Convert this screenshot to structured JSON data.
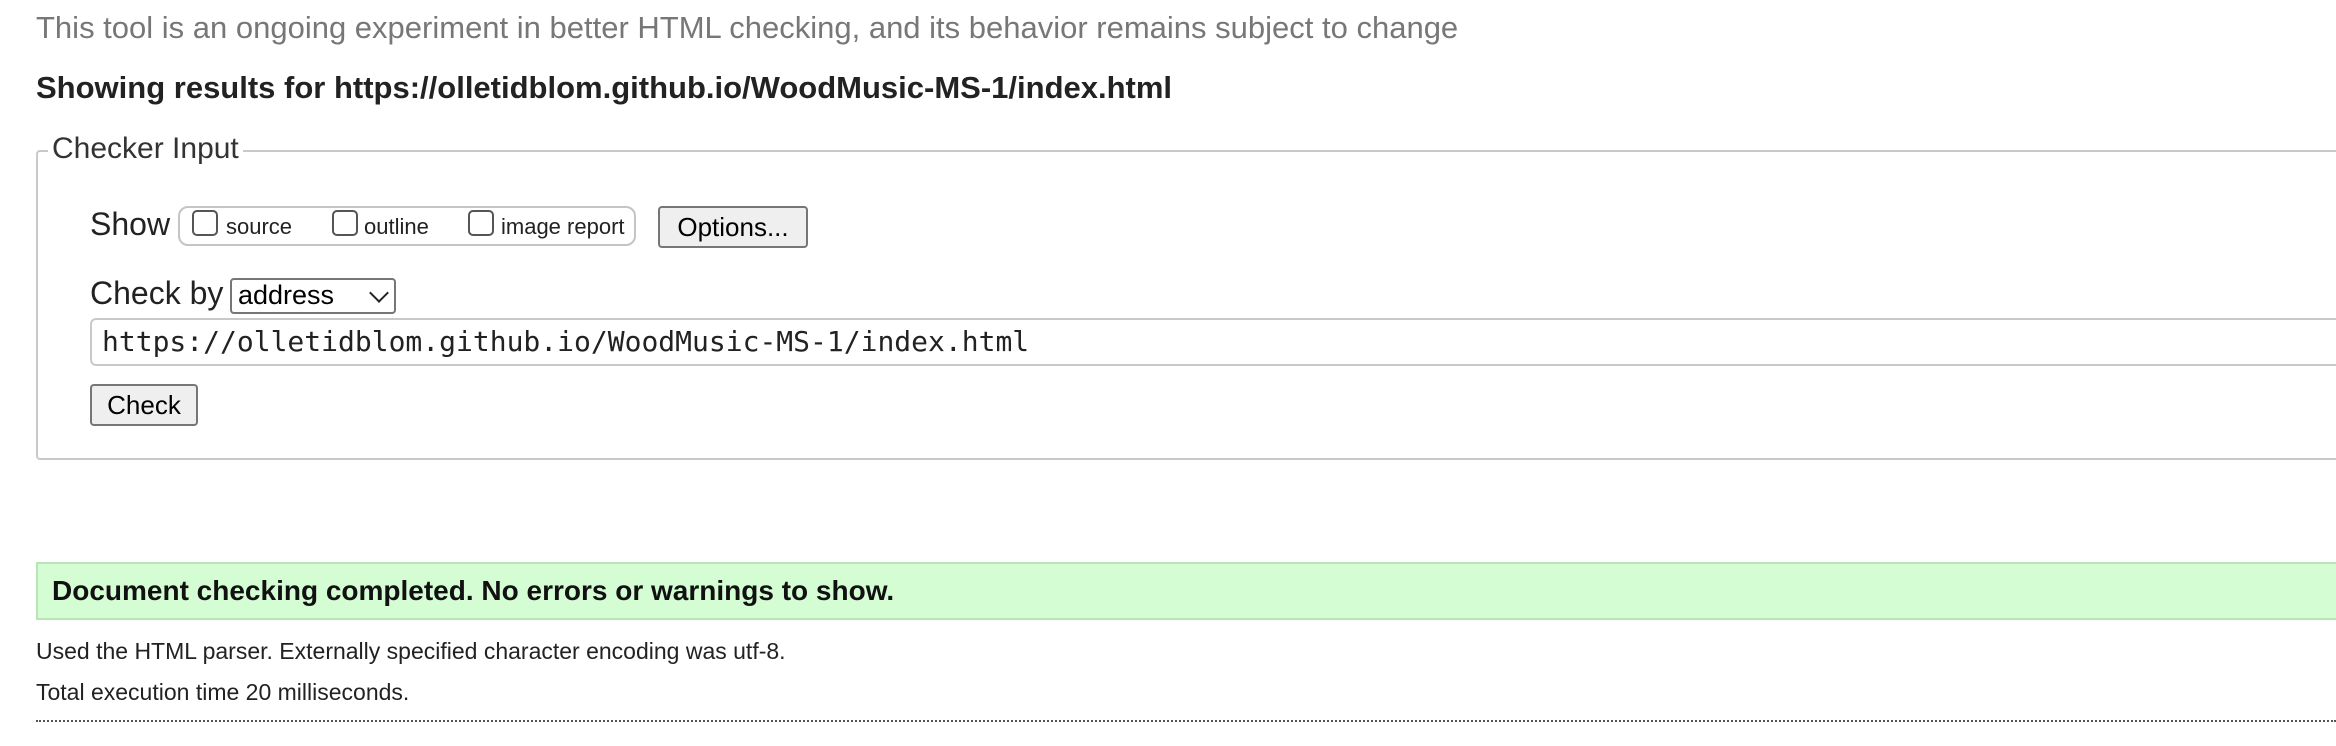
{
  "header": {
    "subtitle": "This tool is an ongoing experiment in better HTML checking, and its behavior remains subject to change",
    "results_heading": "Showing results for https://olletidblom.github.io/WoodMusic-MS-1/index.html"
  },
  "checker": {
    "legend": "Checker Input",
    "show_label": "Show",
    "show_options": [
      {
        "label": "source",
        "checked": false
      },
      {
        "label": "outline",
        "checked": false
      },
      {
        "label": "image report",
        "checked": false
      }
    ],
    "options_button": "Options...",
    "check_by_label": "Check by",
    "check_by_selected": "address",
    "url_value": "https://olletidblom.github.io/WoodMusic-MS-1/index.html",
    "check_button": "Check"
  },
  "results": {
    "success_message": "Document checking completed. No errors or warnings to show.",
    "parser_info": "Used the HTML parser. Externally specified character encoding was utf-8.",
    "execution_time": "Total execution time 20 milliseconds."
  },
  "colors": {
    "success_bg": "#d4fdd4",
    "subtitle_text": "#777777"
  }
}
